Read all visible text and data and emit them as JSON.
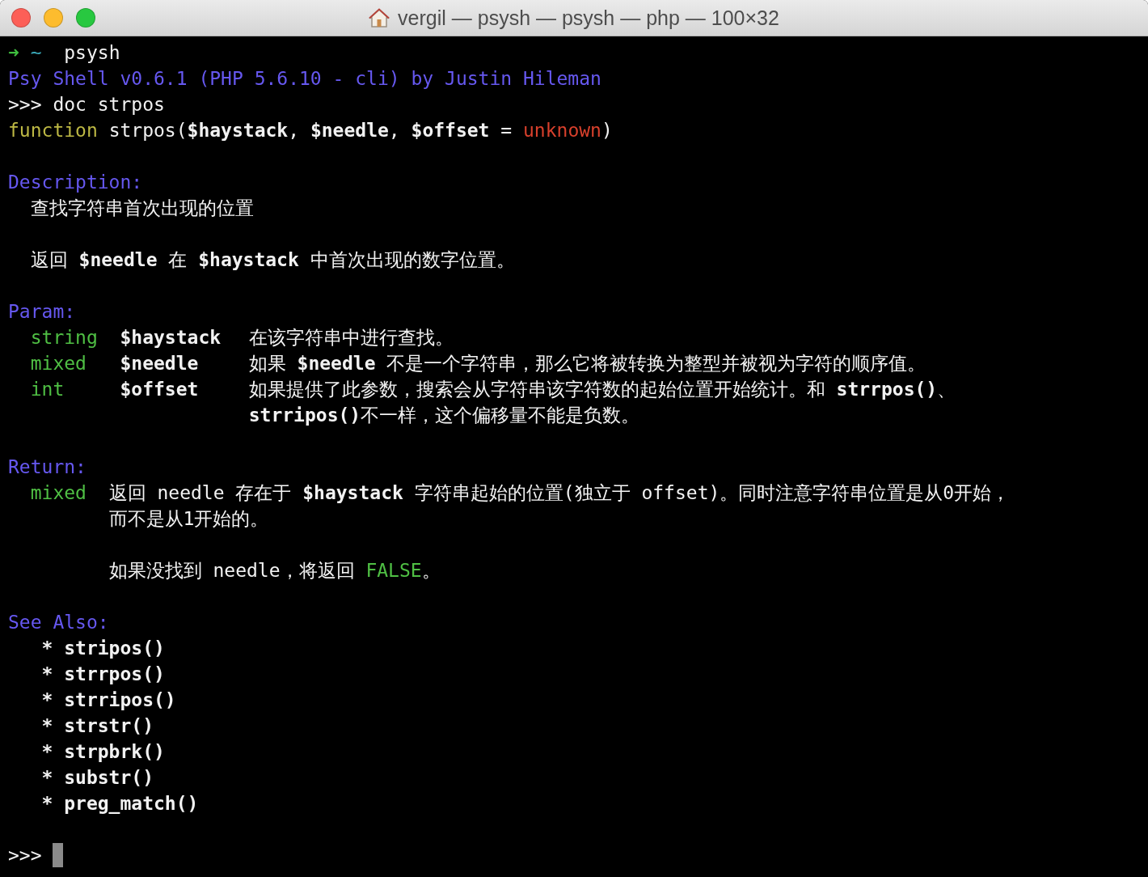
{
  "window": {
    "title": "vergil — psysh — psysh — php — 100×32"
  },
  "blocks": [
    [
      {
        "kind": "shell",
        "arrow": "➜",
        "cwd": "~",
        "command": "psysh"
      },
      {
        "kind": "banner",
        "text": "Psy Shell v0.6.1 (PHP 5.6.10 - cli) by Justin Hileman"
      },
      {
        "kind": "input",
        "prompt": ">>>",
        "command": "doc strpos"
      },
      {
        "kind": "signature",
        "keyword": "function",
        "text": "strpos(**$haystack**, **$needle**, **$offset** = ",
        "default": "unknown",
        "after": ")"
      }
    ],
    [
      {
        "kind": "heading",
        "text": "Description:"
      },
      {
        "kind": "body",
        "text": "查找字符串首次出现的位置"
      }
    ],
    [
      {
        "kind": "body",
        "text": "返回 **$needle** 在 **$haystack** 中首次出现的数字位置。"
      }
    ],
    [
      {
        "kind": "heading",
        "text": "Param:"
      },
      {
        "kind": "param",
        "type": "string",
        "name": "$haystack",
        "text": "在该字符串中进行查找。"
      },
      {
        "kind": "param",
        "type": "mixed",
        "name": "$needle",
        "text": "如果 **$needle** 不是一个字符串，那么它将被转换为整型并被视为字符的顺序值。"
      },
      {
        "kind": "param",
        "type": "int",
        "name": "$offset",
        "text": "如果提供了此参数，搜索会从字符串该字符数的起始位置开始统计。和 **strrpos()**、"
      },
      {
        "kind": "param_cont",
        "text": "**strripos()**不一样，这个偏移量不能是负数。"
      }
    ],
    [
      {
        "kind": "heading",
        "text": "Return:"
      },
      {
        "kind": "return",
        "type": "mixed",
        "text": "返回 needle 存在于 **$haystack** 字符串起始的位置(独立于 offset)。同时注意字符串位置是从0开始，"
      },
      {
        "kind": "return_cont",
        "text": "而不是从1开始的。"
      }
    ],
    [
      {
        "kind": "return_value",
        "text": "如果没找到 needle，将返回 ",
        "value": "FALSE",
        "after": "。"
      }
    ],
    [
      {
        "kind": "heading",
        "text": "See Also:"
      },
      {
        "kind": "see_also",
        "bullet": "*",
        "text": "stripos()"
      },
      {
        "kind": "see_also",
        "bullet": "*",
        "text": "strrpos()"
      },
      {
        "kind": "see_also",
        "bullet": "*",
        "text": "strripos()"
      },
      {
        "kind": "see_also",
        "bullet": "*",
        "text": "strstr()"
      },
      {
        "kind": "see_also",
        "bullet": "*",
        "text": "strpbrk()"
      },
      {
        "kind": "see_also",
        "bullet": "*",
        "text": "substr()"
      },
      {
        "kind": "see_also",
        "bullet": "*",
        "text": "preg_match()"
      }
    ],
    [
      {
        "kind": "cursor_prompt",
        "prompt": ">>>"
      }
    ]
  ]
}
